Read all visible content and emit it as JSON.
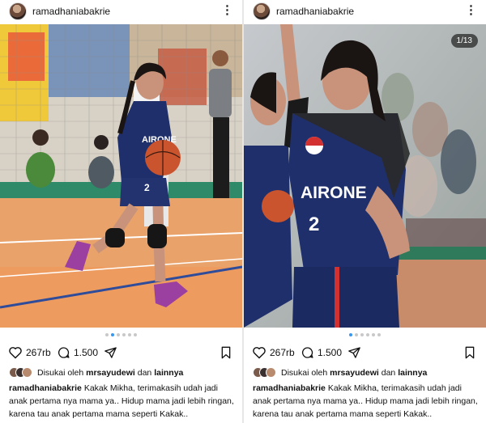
{
  "posts": [
    {
      "username": "ramadhaniabakrie",
      "jersey_team": "AIRONE",
      "jersey_number": "2",
      "likes": "267rb",
      "comments": "1.500",
      "liked_by_prefix": "Disukai oleh",
      "liked_by_user": "mrsayudewi",
      "liked_by_conj": "dan",
      "liked_by_others": "lainnya",
      "caption_user": "ramadhaniabakrie",
      "caption_text": "Kakak Mikha, terimakasih udah jadi anak pertama nya mama ya.. Hidup mama jadi lebih ringan, karena tau anak pertama mama seperti Kakak.."
    },
    {
      "username": "ramadhaniabakrie",
      "jersey_team": "AIRONE",
      "jersey_number": "2",
      "counter": "1/13",
      "likes": "267rb",
      "comments": "1.500",
      "liked_by_prefix": "Disukai oleh",
      "liked_by_user": "mrsayudewi",
      "liked_by_conj": "dan",
      "liked_by_others": "lainnya",
      "caption_user": "ramadhaniabakrie",
      "caption_text": "Kakak Mikha, terimakasih udah jadi anak pertama nya mama ya.. Hidup mama jadi lebih ringan, karena tau anak pertama mama seperti Kakak.."
    }
  ],
  "icons": {
    "more": "more-options-icon",
    "like": "heart-icon",
    "comment": "comment-icon",
    "share": "share-icon",
    "save": "bookmark-icon"
  },
  "colors": {
    "jersey": "#1f2f6b",
    "court": "#e8a26a",
    "active_dot": "#3897f0"
  }
}
